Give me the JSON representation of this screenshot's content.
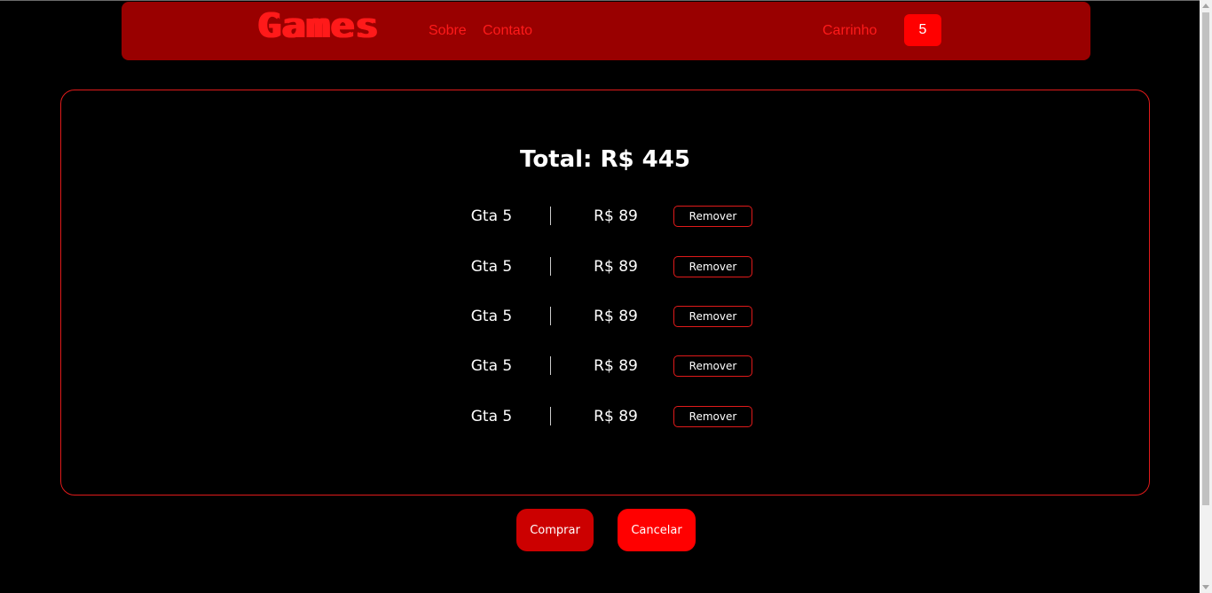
{
  "header": {
    "logo_text": "Games",
    "nav": [
      "Sobre",
      "Contato"
    ],
    "cart_label": "Carrinho",
    "cart_count": "5"
  },
  "cart": {
    "total_label": "Total: R$ 445",
    "items": [
      {
        "name": "Gta 5",
        "price": "R$ 89",
        "remove_label": "Remover"
      },
      {
        "name": "Gta 5",
        "price": "R$ 89",
        "remove_label": "Remover"
      },
      {
        "name": "Gta 5",
        "price": "R$ 89",
        "remove_label": "Remover"
      },
      {
        "name": "Gta 5",
        "price": "R$ 89",
        "remove_label": "Remover"
      },
      {
        "name": "Gta 5",
        "price": "R$ 89",
        "remove_label": "Remover"
      }
    ]
  },
  "actions": {
    "buy_label": "Comprar",
    "cancel_label": "Cancelar"
  },
  "colors": {
    "background": "#000000",
    "navbar": "#990000",
    "accent": "#ff0000",
    "border": "#e01a1a"
  }
}
